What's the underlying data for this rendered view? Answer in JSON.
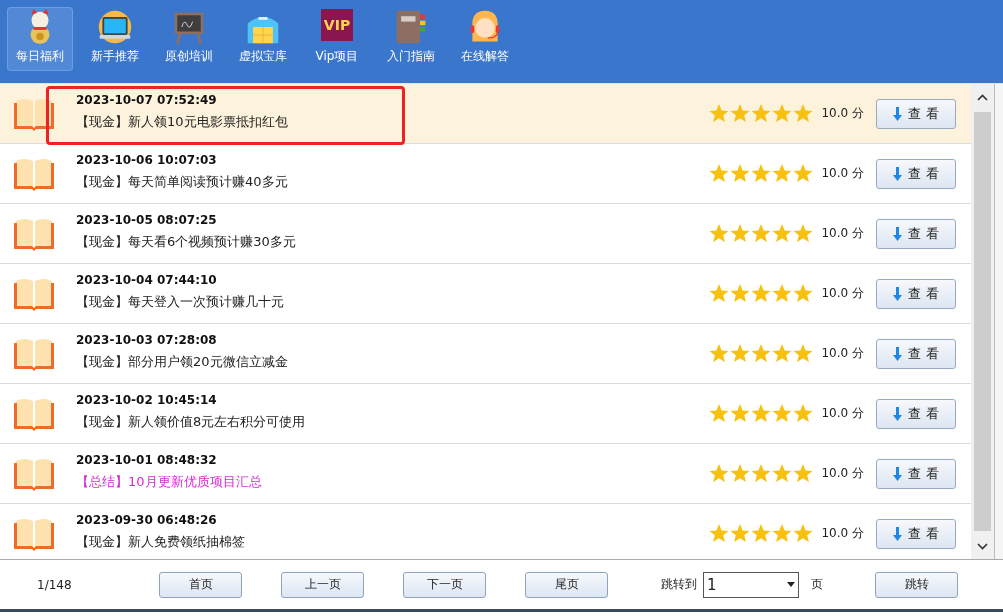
{
  "toolbar": [
    {
      "label": "每日福利",
      "selected": true
    },
    {
      "label": "新手推荐",
      "selected": false
    },
    {
      "label": "原创培训",
      "selected": false
    },
    {
      "label": "虚拟宝库",
      "selected": false
    },
    {
      "label": "Vip项目",
      "selected": false,
      "icon_text": "VIP"
    },
    {
      "label": "入门指南",
      "selected": false
    },
    {
      "label": "在线解答",
      "selected": false
    }
  ],
  "items": [
    {
      "date": "2023-10-07 07:52:49",
      "title": "【现金】新人领10元电影票抵扣红包",
      "kind": "normal",
      "selected": true,
      "circled": true,
      "stars": 5,
      "score": "10.0 分",
      "button": "查 看"
    },
    {
      "date": "2023-10-06 10:07:03",
      "title": "【现金】每天简单阅读预计赚40多元",
      "kind": "normal",
      "selected": false,
      "circled": false,
      "stars": 5,
      "score": "10.0 分",
      "button": "查 看"
    },
    {
      "date": "2023-10-05 08:07:25",
      "title": "【现金】每天看6个视频预计赚30多元",
      "kind": "normal",
      "selected": false,
      "circled": false,
      "stars": 5,
      "score": "10.0 分",
      "button": "查 看"
    },
    {
      "date": "2023-10-04 07:44:10",
      "title": "【现金】每天登入一次预计赚几十元",
      "kind": "normal",
      "selected": false,
      "circled": false,
      "stars": 5,
      "score": "10.0 分",
      "button": "查 看"
    },
    {
      "date": "2023-10-03 07:28:08",
      "title": "【现金】部分用户领20元微信立减金",
      "kind": "normal",
      "selected": false,
      "circled": false,
      "stars": 5,
      "score": "10.0 分",
      "button": "查 看"
    },
    {
      "date": "2023-10-02 10:45:14",
      "title": "【现金】新人领价值8元左右积分可使用",
      "kind": "normal",
      "selected": false,
      "circled": false,
      "stars": 5,
      "score": "10.0 分",
      "button": "查 看"
    },
    {
      "date": "2023-10-01 08:48:32",
      "title": "【总结】10月更新优质项目汇总",
      "kind": "summary",
      "selected": false,
      "circled": false,
      "stars": 5,
      "score": "10.0 分",
      "button": "查 看"
    },
    {
      "date": "2023-09-30 06:48:26",
      "title": "【现金】新人免费领纸抽棉签",
      "kind": "normal",
      "selected": false,
      "circled": false,
      "stars": 5,
      "score": "10.0 分",
      "button": "查 看"
    }
  ],
  "pager": {
    "page_info": "1/148",
    "buttons": [
      "首页",
      "上一页",
      "下一页",
      "尾页"
    ],
    "jump_label": "跳转到",
    "jump_value": "1",
    "page_unit": "页",
    "jump_button": "跳转"
  }
}
